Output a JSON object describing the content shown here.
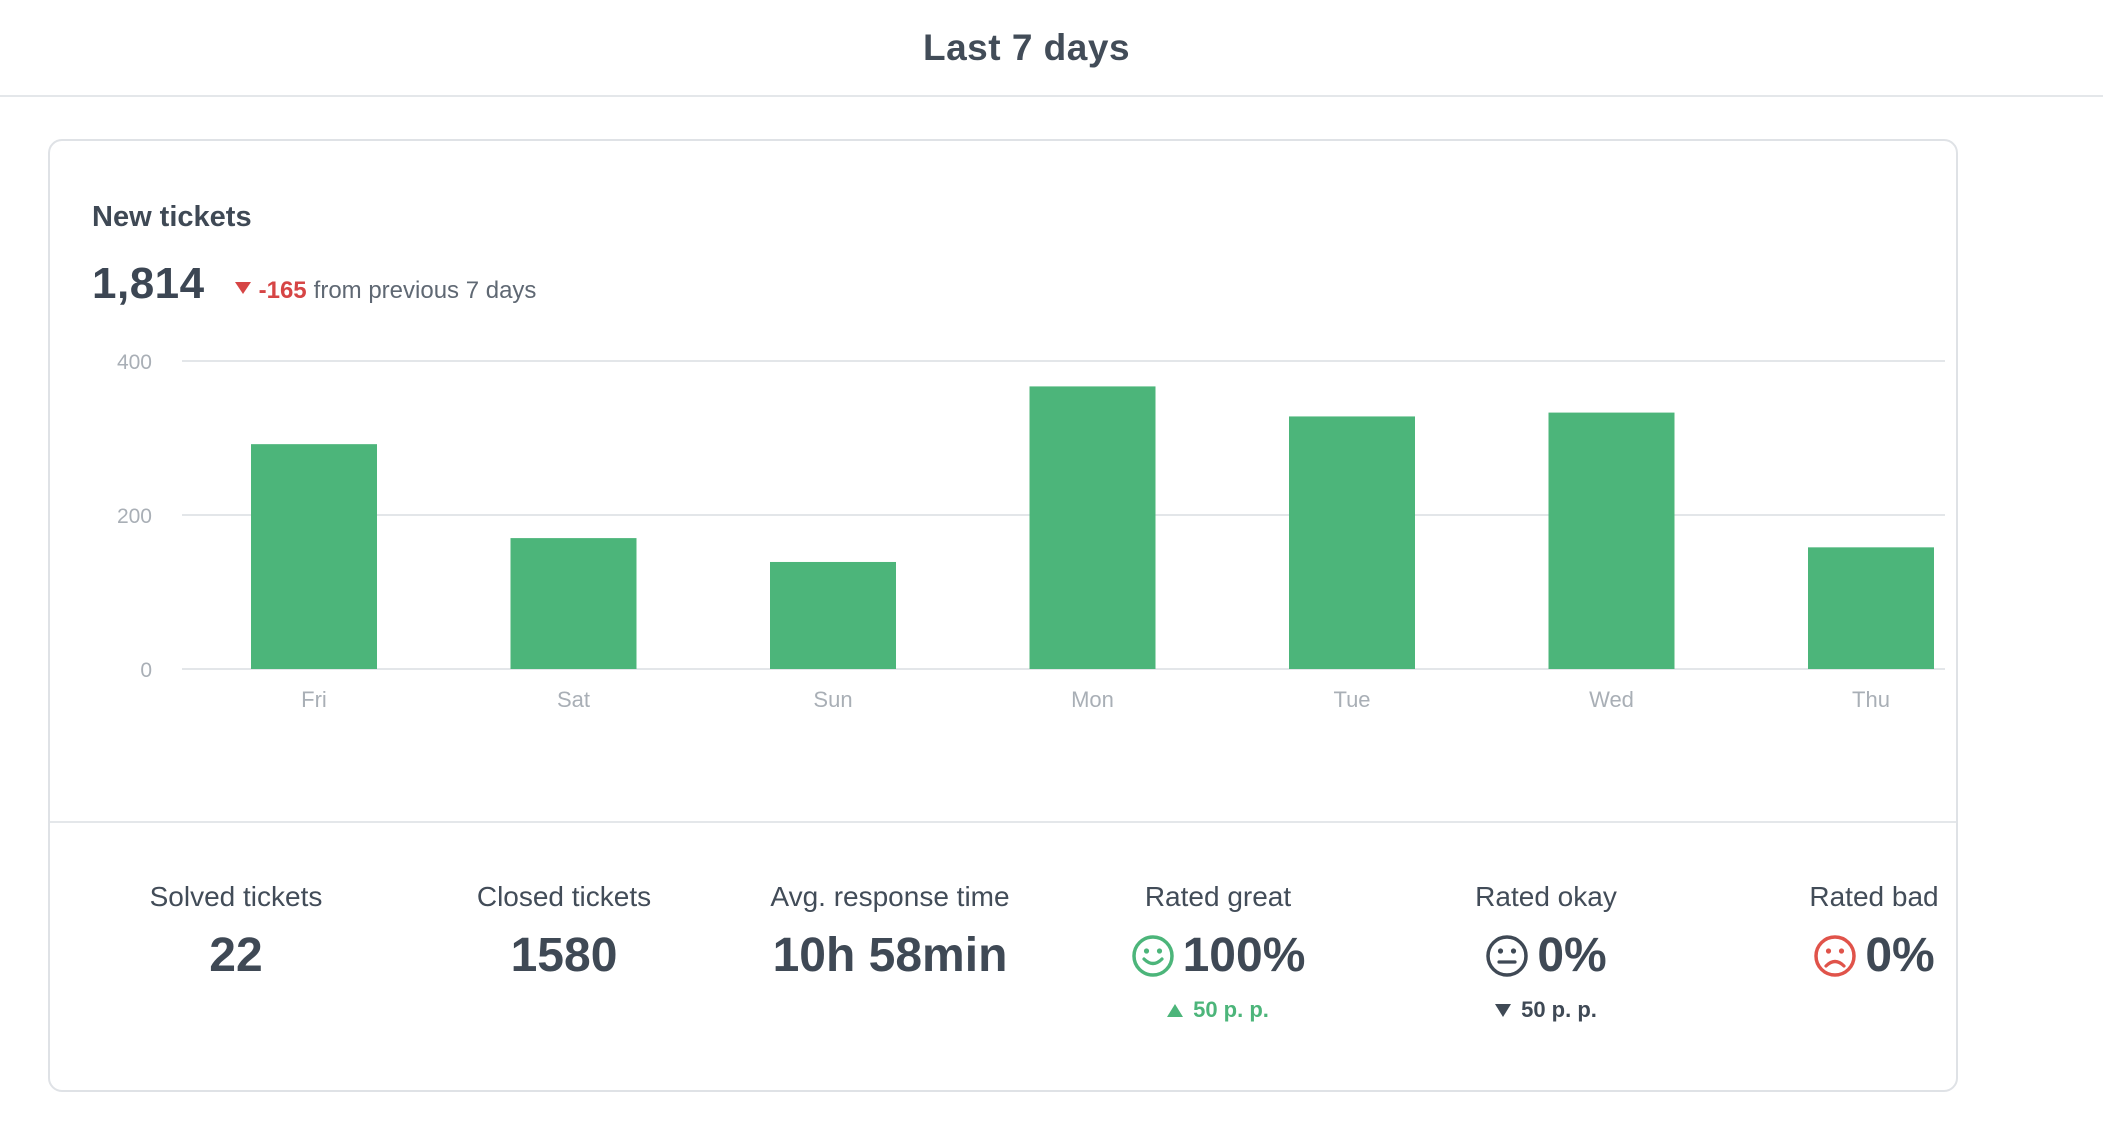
{
  "header": {
    "title": "Last 7 days"
  },
  "card": {
    "title": "New tickets",
    "total": "1,814",
    "delta_value": "-165",
    "delta_text": "from previous 7 days"
  },
  "chart_data": {
    "type": "bar",
    "categories": [
      "Fri",
      "Sat",
      "Sun",
      "Mon",
      "Tue",
      "Wed",
      "Thu"
    ],
    "values": [
      292,
      170,
      139,
      367,
      328,
      333,
      158
    ],
    "yticks": [
      0,
      200,
      400
    ],
    "ylim": [
      0,
      400
    ],
    "grid": true,
    "bar_color": "#4cb57a"
  },
  "stats": {
    "solved": {
      "label": "Solved tickets",
      "value": "22"
    },
    "closed": {
      "label": "Closed tickets",
      "value": "1580"
    },
    "response": {
      "label": "Avg. response time",
      "value": "10h 58min"
    },
    "great": {
      "label": "Rated great",
      "value": "100%",
      "change": "50 p. p.",
      "icon": "smile-icon",
      "color": "#4cb57a"
    },
    "okay": {
      "label": "Rated okay",
      "value": "0%",
      "change": "50 p. p.",
      "icon": "neutral-face-icon",
      "color": "#3f4955"
    },
    "bad": {
      "label": "Rated bad",
      "value": "0%",
      "icon": "frown-icon",
      "color": "#e0534a"
    }
  },
  "colors": {
    "positive": "#4cb57a",
    "negative": "#d64545"
  }
}
